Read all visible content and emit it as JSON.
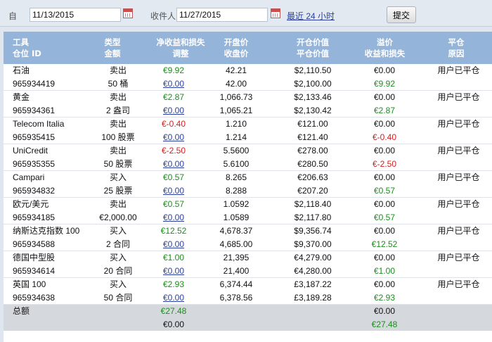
{
  "filter": {
    "from_label": "自",
    "from_value": "11/13/2015",
    "to_label": "收件人",
    "to_value": "11/27/2015",
    "last24_label": "最近 24 小时",
    "submit_label": "提交"
  },
  "headers": [
    [
      "工具",
      "仓位 ID"
    ],
    [
      "类型",
      "金额"
    ],
    [
      "净收益和损失",
      "调整"
    ],
    [
      "开盘价",
      "收盘价"
    ],
    [
      "开仓价值",
      "平仓价值"
    ],
    [
      "溢价",
      "收益和损失"
    ],
    [
      "平仓",
      "原因"
    ]
  ],
  "rows": [
    {
      "name": "石油",
      "id": "965934419",
      "type": "卖出",
      "amount": "50 桶",
      "pnl": "€9.92",
      "pnl_sign": "pos",
      "adj": "€0.00",
      "open": "42.21",
      "close": "42.00",
      "open_val": "$2,110.50",
      "close_val": "$2,100.00",
      "premium": "€0.00",
      "pl": "€9.92",
      "pl_sign": "pos",
      "reason": "用户已平仓"
    },
    {
      "name": "黄金",
      "id": "965934361",
      "type": "卖出",
      "amount": "2 盎司",
      "pnl": "€2.87",
      "pnl_sign": "pos",
      "adj": "€0.00",
      "open": "1,066.73",
      "close": "1,065.21",
      "open_val": "$2,133.46",
      "close_val": "$2,130.42",
      "premium": "€0.00",
      "pl": "€2.87",
      "pl_sign": "pos",
      "reason": "用户已平仓"
    },
    {
      "name": "Telecom Italia",
      "id": "965935415",
      "type": "卖出",
      "amount": "100 股票",
      "pnl": "€-0.40",
      "pnl_sign": "neg",
      "adj": "€0.00",
      "open": "1.210",
      "close": "1.214",
      "open_val": "€121.00",
      "close_val": "€121.40",
      "premium": "€0.00",
      "pl": "€-0.40",
      "pl_sign": "neg",
      "reason": "用户已平仓"
    },
    {
      "name": "UniCredit",
      "id": "965935355",
      "type": "卖出",
      "amount": "50 股票",
      "pnl": "€-2.50",
      "pnl_sign": "neg",
      "adj": "€0.00",
      "open": "5.5600",
      "close": "5.6100",
      "open_val": "€278.00",
      "close_val": "€280.50",
      "premium": "€0.00",
      "pl": "€-2.50",
      "pl_sign": "neg",
      "reason": "用户已平仓"
    },
    {
      "name": "Campari",
      "id": "965934832",
      "type": "买入",
      "amount": "25 股票",
      "pnl": "€0.57",
      "pnl_sign": "pos",
      "adj": "€0.00",
      "open": "8.265",
      "close": "8.288",
      "open_val": "€206.63",
      "close_val": "€207.20",
      "premium": "€0.00",
      "pl": "€0.57",
      "pl_sign": "pos",
      "reason": "用户已平仓"
    },
    {
      "name": "欧元/美元",
      "id": "965934185",
      "type": "卖出",
      "amount": "€2,000.00",
      "pnl": "€0.57",
      "pnl_sign": "pos",
      "adj": "€0.00",
      "open": "1.0592",
      "close": "1.0589",
      "open_val": "$2,118.40",
      "close_val": "$2,117.80",
      "premium": "€0.00",
      "pl": "€0.57",
      "pl_sign": "pos",
      "reason": "用户已平仓"
    },
    {
      "name": "纳斯达克指数 100",
      "id": "965934588",
      "type": "买入",
      "amount": "2 合同",
      "pnl": "€12.52",
      "pnl_sign": "pos",
      "adj": "€0.00",
      "open": "4,678.37",
      "close": "4,685.00",
      "open_val": "$9,356.74",
      "close_val": "$9,370.00",
      "premium": "€0.00",
      "pl": "€12.52",
      "pl_sign": "pos",
      "reason": "用户已平仓"
    },
    {
      "name": "德国中型股",
      "id": "965934614",
      "type": "买入",
      "amount": "20 合同",
      "pnl": "€1.00",
      "pnl_sign": "pos",
      "adj": "€0.00",
      "open": "21,395",
      "close": "21,400",
      "open_val": "€4,279.00",
      "close_val": "€4,280.00",
      "premium": "€0.00",
      "pl": "€1.00",
      "pl_sign": "pos",
      "reason": "用户已平仓"
    },
    {
      "name": "英国 100",
      "id": "965934638",
      "type": "买入",
      "amount": "50 合同",
      "pnl": "€2.93",
      "pnl_sign": "pos",
      "adj": "€0.00",
      "open": "6,374.44",
      "close": "6,378.56",
      "open_val": "£3,187.22",
      "close_val": "£3,189.28",
      "premium": "€0.00",
      "pl": "€2.93",
      "pl_sign": "pos",
      "reason": "用户已平仓"
    }
  ],
  "total": {
    "label": "总额",
    "pnl": "€27.48",
    "adj": "€0.00",
    "premium": "€0.00",
    "pl": "€27.48"
  },
  "colors": {
    "header_bg": "#95b4da",
    "positive": "#1e8c1e",
    "negative": "#d42020",
    "link": "#2b3f9e"
  }
}
